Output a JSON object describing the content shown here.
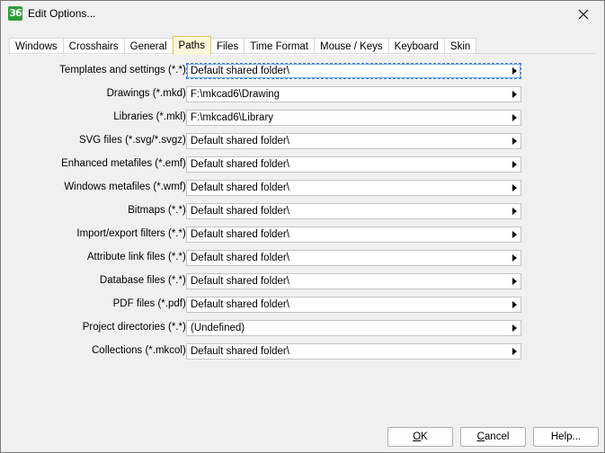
{
  "window": {
    "title": "Edit Options...",
    "app_icon_text": "36"
  },
  "tabs": [
    {
      "label": "Windows",
      "active": false
    },
    {
      "label": "Crosshairs",
      "active": false
    },
    {
      "label": "General",
      "active": false
    },
    {
      "label": "Paths",
      "active": true
    },
    {
      "label": "Files",
      "active": false
    },
    {
      "label": "Time Format",
      "active": false
    },
    {
      "label": "Mouse / Keys",
      "active": false
    },
    {
      "label": "Keyboard",
      "active": false
    },
    {
      "label": "Skin",
      "active": false
    }
  ],
  "paths": [
    {
      "label": "Templates and settings (*.*):",
      "value": "Default shared folder\\"
    },
    {
      "label": "Drawings (*.mkd):",
      "value": "F:\\mkcad6\\Drawing"
    },
    {
      "label": "Libraries (*.mkl):",
      "value": "F:\\mkcad6\\Library"
    },
    {
      "label": "SVG files (*.svg/*.svgz):",
      "value": "Default shared folder\\"
    },
    {
      "label": "Enhanced metafiles (*.emf):",
      "value": "Default shared folder\\"
    },
    {
      "label": "Windows metafiles (*.wmf):",
      "value": "Default shared folder\\"
    },
    {
      "label": "Bitmaps (*.*):",
      "value": "Default shared folder\\"
    },
    {
      "label": "Import/export filters (*.*):",
      "value": "Default shared folder\\"
    },
    {
      "label": "Attribute link files (*.*):",
      "value": "Default shared folder\\"
    },
    {
      "label": "Database files (*.*):",
      "value": "Default shared folder\\"
    },
    {
      "label": "PDF files (*.pdf):",
      "value": "Default shared folder\\"
    },
    {
      "label": "Project directories (*.*):",
      "value": "(Undefined)"
    },
    {
      "label": "Collections (*.mkcol):",
      "value": "Default shared folder\\"
    }
  ],
  "buttons": {
    "ok_first": "O",
    "ok_rest": "K",
    "cancel_first": "C",
    "cancel_rest": "ancel",
    "help": "Help..."
  }
}
